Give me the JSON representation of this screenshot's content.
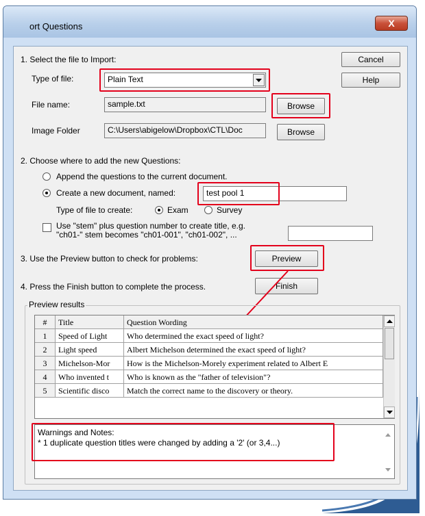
{
  "window": {
    "title": "ort Questions",
    "close_glyph": "X"
  },
  "step1": {
    "label": "1.  Select the file to Import:",
    "type_label": "Type of file:",
    "type_value": "Plain Text",
    "file_label": "File name:",
    "file_value": "sample.txt",
    "browse_label": "Browse",
    "image_label": "Image Folder",
    "image_value": "C:\\Users\\abigelow\\Dropbox\\CTL\\Doc",
    "image_browse_label": "Browse"
  },
  "side_buttons": {
    "cancel": "Cancel",
    "help": "Help"
  },
  "step2": {
    "label": "2.  Choose where to add the new Questions:",
    "append_label": "Append the questions to the current document.",
    "create_label": "Create a new document, named:",
    "create_value": "test pool 1",
    "type_create_label": "Type of file to create:",
    "exam_label": "Exam",
    "survey_label": "Survey",
    "stem_line1": "Use \"stem\" plus question number to create title,  e.g.",
    "stem_line2": "\"ch01-\" stem becomes \"ch01-001\",  \"ch01-002\",  ...",
    "stem_value": ""
  },
  "step3": {
    "label": "3.  Use the Preview button to check for problems:",
    "preview_label": "Preview"
  },
  "step4": {
    "label": "4.  Press the Finish button to complete the process.",
    "finish_label": "Finish"
  },
  "preview": {
    "group_label": "Preview results",
    "columns": [
      "#",
      "Title",
      "Question Wording"
    ],
    "rows": [
      [
        "1",
        "Speed of Light",
        "Who determined the exact speed of light?"
      ],
      [
        "2",
        "Light speed",
        "Albert Michelson determined the exact speed of light?"
      ],
      [
        "3",
        "Michelson-Mor",
        "How is the Michelson-Morely experiment related to Albert E"
      ],
      [
        "4",
        "Who invented t",
        "Who is known as the \"father of television\"?"
      ],
      [
        "5",
        "Scientific disco",
        "Match the correct name to the discovery or theory."
      ]
    ],
    "notes_line1": "Warnings and Notes:",
    "notes_line2": "* 1 duplicate question titles were changed by adding a '2' (or 3,4...)"
  },
  "colors": {
    "highlight": "#e3001b",
    "dialog_bg": "#f0f0f0",
    "frame": "#cfe0f4"
  },
  "icons": {
    "dropdown": "triangle-down-icon",
    "scroll_up": "triangle-up-icon",
    "scroll_down": "triangle-down-icon"
  }
}
